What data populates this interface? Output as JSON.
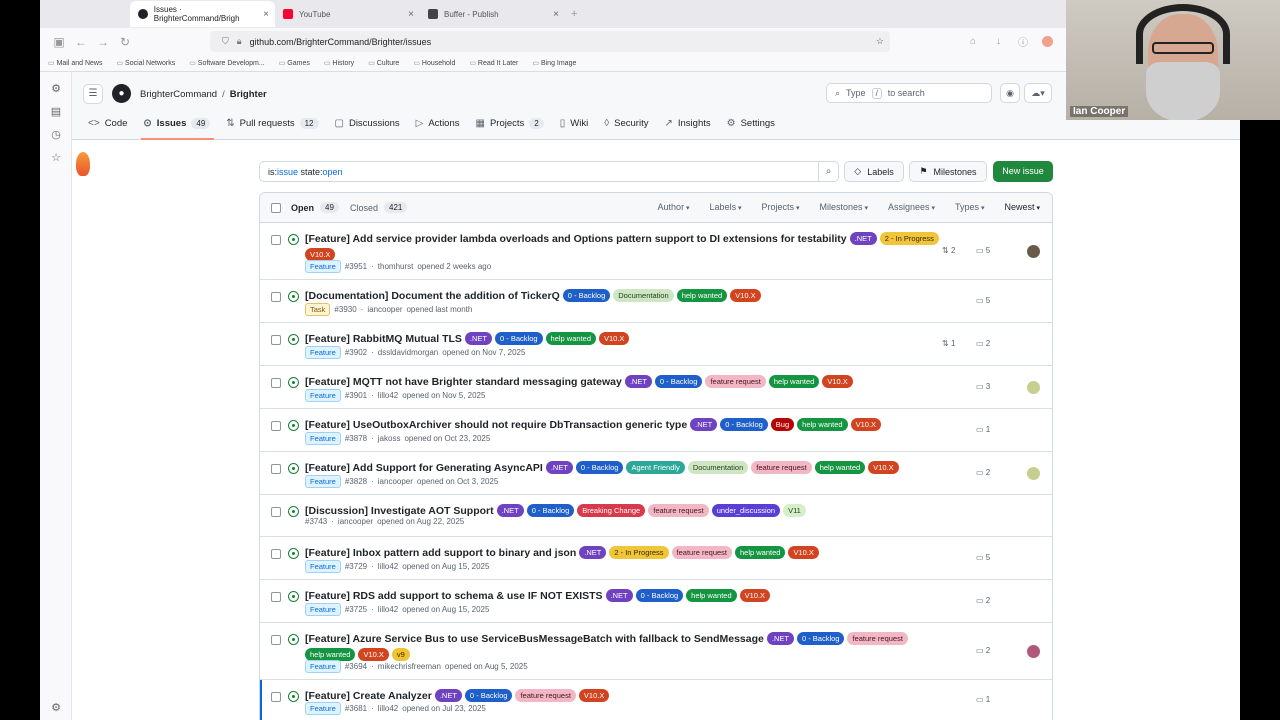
{
  "browser": {
    "tabs": [
      {
        "label": "Issues · BrighterCommand/Brigh",
        "active": true
      },
      {
        "label": "YouTube",
        "active": false
      },
      {
        "label": "Buffer - Publish",
        "active": false
      }
    ],
    "url": "github.com/BrighterCommand/Brighter/issues",
    "bookmarks": [
      "Mail and News",
      "Social Networks",
      "Software Developm...",
      "Games",
      "History",
      "Culture",
      "Household",
      "Read It Later",
      "Bing Image"
    ]
  },
  "repo": {
    "owner": "BrighterCommand",
    "name": "Brighter",
    "search_placeholder_pre": "Type",
    "search_key": "/",
    "search_placeholder_post": "to search",
    "nav": [
      {
        "label": "Code",
        "icon": "code-icon",
        "glyph": "<>"
      },
      {
        "label": "Issues",
        "icon": "issue-icon",
        "glyph": "⊙",
        "count": "49",
        "selected": true
      },
      {
        "label": "Pull requests",
        "icon": "pull-request-icon",
        "glyph": "⇅",
        "count": "12"
      },
      {
        "label": "Discussions",
        "icon": "discussion-icon",
        "glyph": "▢"
      },
      {
        "label": "Actions",
        "icon": "play-icon",
        "glyph": "▷"
      },
      {
        "label": "Projects",
        "icon": "table-icon",
        "glyph": "▦",
        "count": "2"
      },
      {
        "label": "Wiki",
        "icon": "book-icon",
        "glyph": "▯"
      },
      {
        "label": "Security",
        "icon": "shield-icon",
        "glyph": "◊"
      },
      {
        "label": "Insights",
        "icon": "graph-icon",
        "glyph": "↗"
      },
      {
        "label": "Settings",
        "icon": "gear-icon",
        "glyph": "⚙"
      }
    ]
  },
  "filter": {
    "prefix": "is:",
    "kw1": "issue",
    "mid": " state:",
    "kw2": "open"
  },
  "buttons": {
    "labels": "Labels",
    "milestones": "Milestones",
    "new_issue": "New issue"
  },
  "list": {
    "open_label": "Open",
    "open_count": "49",
    "closed_label": "Closed",
    "closed_count": "421",
    "sorts": [
      "Author",
      "Labels",
      "Projects",
      "Milestones",
      "Assignees",
      "Types",
      "Newest"
    ]
  },
  "label_colors": {
    ".NET": [
      "#6f42c1",
      "#fff"
    ],
    "2 - In Progress": [
      "#f0c53a",
      "#3a2a00"
    ],
    "V10.X": [
      "#d1441f",
      "#fff"
    ],
    "0 - Backlog": [
      "#1f5fc9",
      "#fff"
    ],
    "Documentation": [
      "#cfe6c4",
      "#1f3d13"
    ],
    "help wanted": [
      "#159441",
      "#fff"
    ],
    "feature request": [
      "#f2b7c4",
      "#4a1322"
    ],
    "Bug": [
      "#b60205",
      "#fff"
    ],
    "Agent Friendly": [
      "#2ea79b",
      "#fff"
    ],
    "Breaking Change": [
      "#d73a4a",
      "#fff"
    ],
    "under_discussion": [
      "#5a3fd6",
      "#fff"
    ],
    "V11": [
      "#d4efc9",
      "#1f3d13"
    ],
    "v9": [
      "#f1c232",
      "#3a2a00"
    ]
  },
  "issues": [
    {
      "title": "[Feature] Add service provider lambda overloads and Options pattern support to DI extensions for testability",
      "labels": [
        ".NET",
        "2 - In Progress",
        "V10.X"
      ],
      "type": "Feature",
      "number": "#3951",
      "author": "thomhurst",
      "when": "opened 2 weeks ago",
      "prs": "2",
      "comments": "5",
      "avatar": "#6a5a4a"
    },
    {
      "title": "[Documentation] Document the addition of TickerQ",
      "labels": [
        "0 - Backlog",
        "Documentation",
        "help wanted",
        "V10.X"
      ],
      "type": "Task",
      "number": "#3930",
      "author": "iancooper",
      "when": "opened last month",
      "prs": "",
      "comments": "5",
      "avatar": ""
    },
    {
      "title": "[Feature] RabbitMQ Mutual TLS",
      "labels": [
        ".NET",
        "0 - Backlog",
        "help wanted",
        "V10.X"
      ],
      "type": "Feature",
      "number": "#3902",
      "author": "dssldavidmorgan",
      "when": "opened on Nov 7, 2025",
      "prs": "1",
      "comments": "2",
      "avatar": ""
    },
    {
      "title": "[Feature] MQTT not have Brighter standard messaging gateway",
      "labels": [
        ".NET",
        "0 - Backlog",
        "feature request",
        "help wanted",
        "V10.X"
      ],
      "type": "Feature",
      "number": "#3901",
      "author": "lillo42",
      "when": "opened on Nov 5, 2025",
      "prs": "",
      "comments": "3",
      "avatar": "#c7cf8f"
    },
    {
      "title": "[Feature] UseOutboxArchiver should not require DbTransaction generic type",
      "labels": [
        ".NET",
        "0 - Backlog",
        "Bug",
        "help wanted",
        "V10.X"
      ],
      "type": "Feature",
      "number": "#3878",
      "author": "jakoss",
      "when": "opened on Oct 23, 2025",
      "prs": "",
      "comments": "1",
      "avatar": ""
    },
    {
      "title": "[Feature] Add Support for Generating AsyncAPI",
      "labels": [
        ".NET",
        "0 - Backlog",
        "Agent Friendly",
        "Documentation",
        "feature request",
        "help wanted",
        "V10.X"
      ],
      "type": "Feature",
      "number": "#3828",
      "author": "iancooper",
      "when": "opened on Oct 3, 2025",
      "prs": "",
      "comments": "2",
      "avatar": "#c7cf8f"
    },
    {
      "title": "[Discussion] Investigate AOT Support",
      "labels": [
        ".NET",
        "0 - Backlog",
        "Breaking Change",
        "feature request",
        "under_discussion",
        "V11"
      ],
      "type": "",
      "number": "#3743",
      "author": "iancooper",
      "when": "opened on Aug 22, 2025",
      "prs": "",
      "comments": "",
      "avatar": ""
    },
    {
      "title": "[Feature] Inbox pattern add support to binary and json",
      "labels": [
        ".NET",
        "2 - In Progress",
        "feature request",
        "help wanted",
        "V10.X"
      ],
      "type": "Feature",
      "number": "#3729",
      "author": "lillo42",
      "when": "opened on Aug 15, 2025",
      "prs": "",
      "comments": "5",
      "avatar": ""
    },
    {
      "title": "[Feature] RDS add support to schema & use IF NOT EXISTS",
      "labels": [
        ".NET",
        "0 - Backlog",
        "help wanted",
        "V10.X"
      ],
      "type": "Feature",
      "number": "#3725",
      "author": "lillo42",
      "when": "opened on Aug 15, 2025",
      "prs": "",
      "comments": "2",
      "avatar": ""
    },
    {
      "title": "[Feature] Azure Service Bus to use ServiceBusMessageBatch with fallback to SendMessage",
      "labels": [
        ".NET",
        "0 - Backlog",
        "feature request",
        "help wanted",
        "V10.X",
        "v9"
      ],
      "type": "Feature",
      "number": "#3694",
      "author": "mikechrisfreeman",
      "when": "opened on Aug 5, 2025",
      "prs": "",
      "comments": "2",
      "avatar": "#b0587a"
    },
    {
      "title": "[Feature] Create Analyzer",
      "labels": [
        ".NET",
        "0 - Backlog",
        "feature request",
        "V10.X"
      ],
      "type": "Feature",
      "number": "#3681",
      "author": "lillo42",
      "when": "opened on Jul 23, 2025",
      "prs": "",
      "comments": "1",
      "avatar": ""
    }
  ],
  "webcam": {
    "name": "Ian Cooper"
  }
}
